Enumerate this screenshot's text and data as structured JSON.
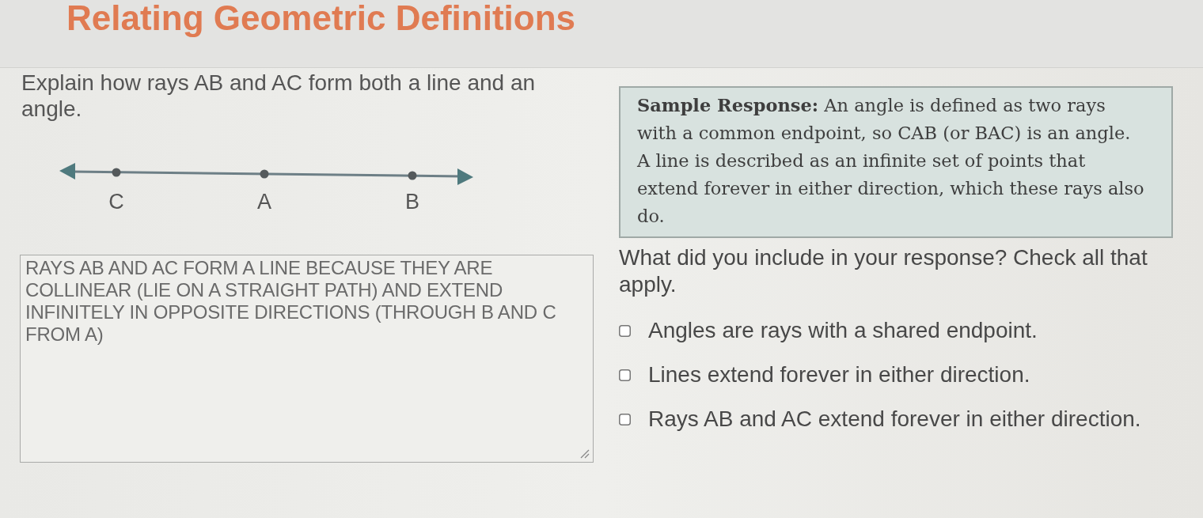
{
  "header": {
    "title": "Relating Geometric Definitions"
  },
  "prompt": "Explain how rays AB and AC form both a line and an angle.",
  "diagram": {
    "points": [
      {
        "label": "C"
      },
      {
        "label": "A"
      },
      {
        "label": "B"
      }
    ]
  },
  "answer_box": {
    "value": "RAYS AB AND AC FORM A LINE BECAUSE THEY ARE COLLINEAR (LIE ON A STRAIGHT PATH) AND EXTEND INFINITELY IN OPPOSITE DIRECTIONS (THROUGH B AND C FROM A)"
  },
  "sample_response": "**Sample Response:** An angle is defined as two rays with a common endpoint, so CAB (or BAC) is an angle. A line is described as an infinite set of points that extend forever in either direction, which these rays also do.",
  "question": "What did you include in your response? Check all that apply.",
  "options": [
    {
      "label": "Angles are rays with a shared endpoint.",
      "checked": false
    },
    {
      "label": "Lines extend forever in either direction.",
      "checked": false
    },
    {
      "label": "Rays AB and AC extend forever in either direction.",
      "checked": false
    }
  ]
}
